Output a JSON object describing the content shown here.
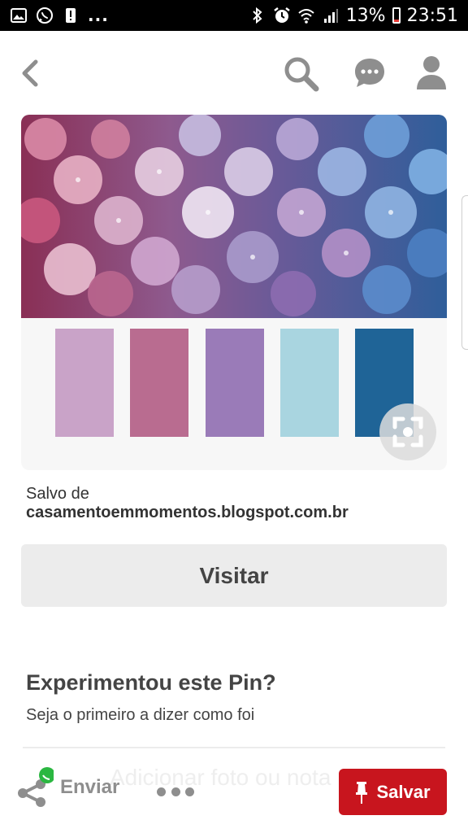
{
  "status_bar": {
    "battery_percent": "13%",
    "time": "23:51",
    "overflow": "...",
    "notification_icons": [
      "image-icon",
      "whatsapp-icon",
      "alert-icon"
    ],
    "system_icons": [
      "bluetooth-icon",
      "alarm-icon",
      "wifi-icon",
      "signal-icon",
      "battery-icon"
    ]
  },
  "top_nav": {
    "icons": [
      "back-arrow-icon",
      "search-icon",
      "chat-icon",
      "profile-icon"
    ]
  },
  "pin": {
    "image": "hydrangea-petals-photo",
    "palette": [
      "#c9a3c8",
      "#b96c90",
      "#9a7bb8",
      "#a9d5e0",
      "#1f6497"
    ],
    "lens_icon": "visual-search-icon"
  },
  "source": {
    "saved_from_label": "Salvo de",
    "domain": "casamentoemmomentos.blogspot.com.br"
  },
  "visit_button": {
    "label": "Visitar"
  },
  "tried_section": {
    "title": "Experimentou este Pin?",
    "subtitle": "Seja o primeiro a dizer como foi",
    "hint": "Adicionar foto ou nota"
  },
  "bottom_bar": {
    "send_label": "Enviar",
    "save_label": "Salvar"
  },
  "colors": {
    "accent_red": "#c8151e",
    "icon_gray": "#8e8e8e",
    "button_gray": "#ececec"
  }
}
